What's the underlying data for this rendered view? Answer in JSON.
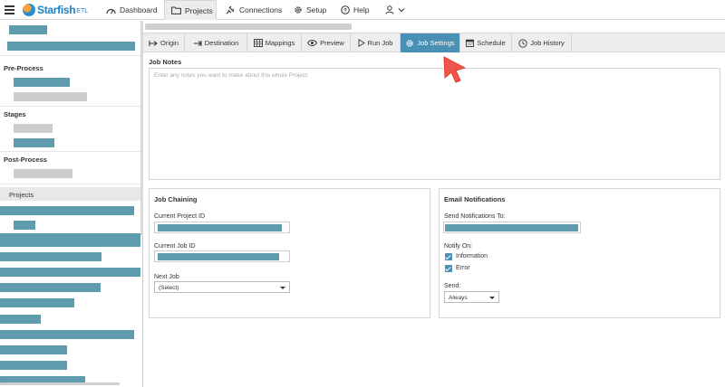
{
  "app": {
    "logo_name": "Starfish",
    "logo_suffix": "ETL",
    "colors": {
      "accent": "#4a8fb4",
      "teal_bar": "#5f9cad",
      "grey_bar": "#cdcdcd",
      "cursor": "#f0554a"
    }
  },
  "nav": {
    "items": [
      {
        "label": "Dashboard",
        "icon": "dashboard-icon"
      },
      {
        "label": "Projects",
        "icon": "folder-icon",
        "active": true
      },
      {
        "label": "Connections",
        "icon": "plug-icon"
      },
      {
        "label": "Setup",
        "icon": "gear-icon"
      },
      {
        "label": "Help",
        "icon": "help-icon"
      }
    ],
    "user_icon": "user-icon"
  },
  "sidebar": {
    "pre_process": "Pre-Process",
    "stages": "Stages",
    "post_process": "Post-Process",
    "projects": "Projects"
  },
  "tabs": [
    {
      "label": "Origin",
      "icon": "origin-icon"
    },
    {
      "label": "Destination",
      "icon": "destination-icon"
    },
    {
      "label": "Mappings",
      "icon": "grid-icon"
    },
    {
      "label": "Preview",
      "icon": "eye-icon"
    },
    {
      "label": "Run Job",
      "icon": "play-icon"
    },
    {
      "label": "Job Settings",
      "icon": "gear-icon",
      "active": true
    },
    {
      "label": "Schedule",
      "icon": "calendar-icon"
    },
    {
      "label": "Job History",
      "icon": "clock-icon"
    }
  ],
  "job_notes": {
    "title": "Job Notes",
    "placeholder": "Enter any notes you want to make about this whole Project."
  },
  "job_chaining": {
    "title": "Job Chaining",
    "current_project_label": "Current Project ID",
    "current_job_label": "Current Job ID",
    "next_job_label": "Next Job",
    "next_job_value": "(Select)"
  },
  "email_notifications": {
    "title": "Email Notifications",
    "send_to_label": "Send Notifications To:",
    "notify_on_label": "Notify On:",
    "information_label": "Information",
    "information_checked": true,
    "error_label": "Error",
    "error_checked": true,
    "send_label": "Send:",
    "send_value": "Always"
  }
}
